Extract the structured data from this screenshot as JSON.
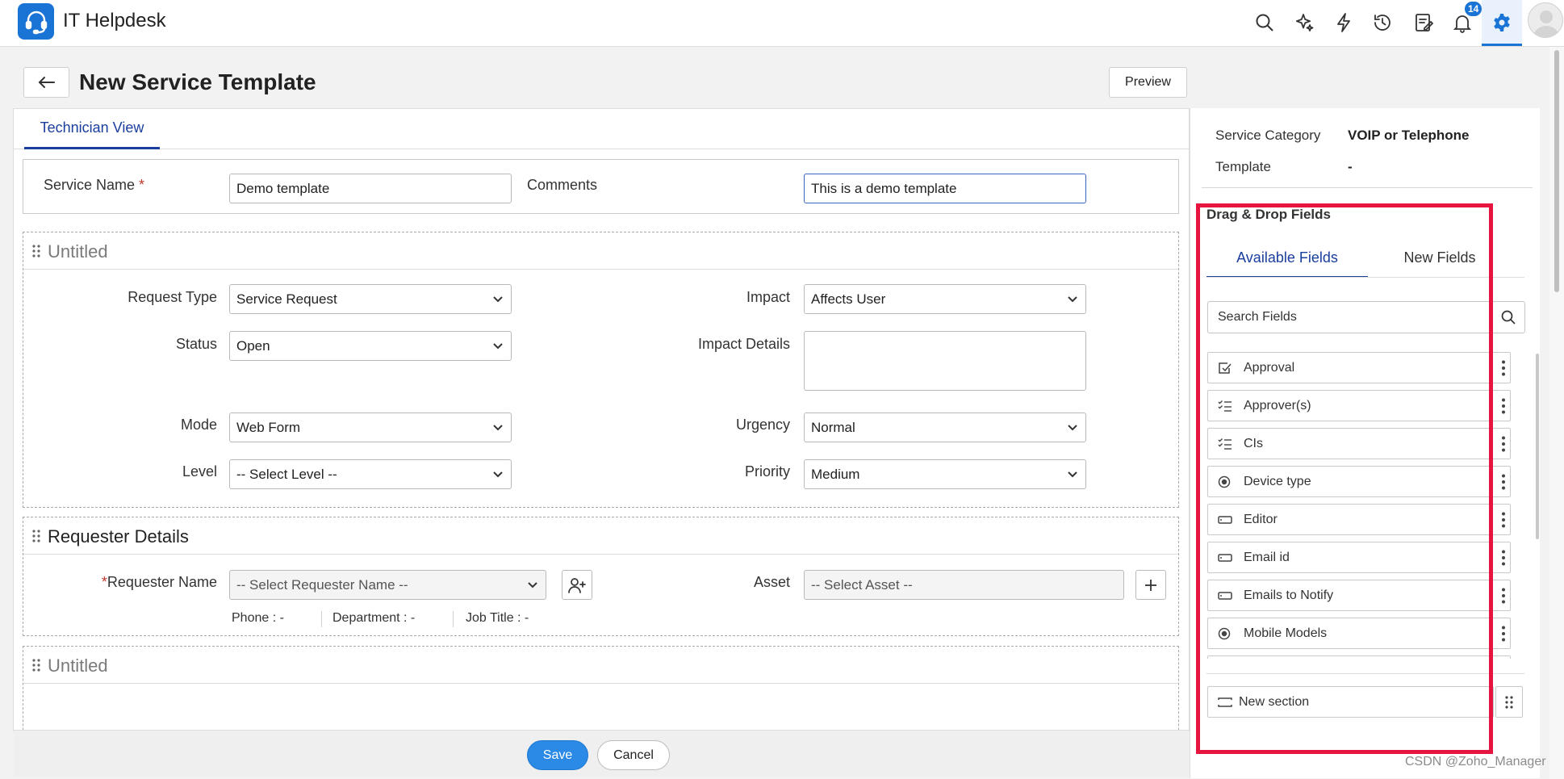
{
  "app": {
    "title": "IT Helpdesk",
    "notification_count": "14"
  },
  "page": {
    "title": "New Service Template",
    "preview_label": "Preview"
  },
  "tabs": [
    {
      "label": "Technician View"
    }
  ],
  "header_section": {
    "service_name_label": "Service Name",
    "service_name_value": "Demo template",
    "comments_label": "Comments",
    "comments_value": "This is a demo template"
  },
  "section1": {
    "title": "Untitled",
    "request_type": {
      "label": "Request Type",
      "value": "Service Request"
    },
    "status": {
      "label": "Status",
      "value": "Open"
    },
    "mode": {
      "label": "Mode",
      "value": "Web Form"
    },
    "level": {
      "label": "Level",
      "value": "-- Select Level --"
    },
    "impact": {
      "label": "Impact",
      "value": "Affects User"
    },
    "impact_details": {
      "label": "Impact Details"
    },
    "urgency": {
      "label": "Urgency",
      "value": "Normal"
    },
    "priority": {
      "label": "Priority",
      "value": "Medium"
    }
  },
  "requester_section": {
    "title": "Requester Details",
    "requester_name": {
      "label": "Requester Name",
      "placeholder": "-- Select Requester Name --"
    },
    "asset": {
      "label": "Asset",
      "placeholder": "-- Select Asset --"
    },
    "phone": "Phone  :  -",
    "department": "Department  :  -",
    "job_title": "Job Title  :  -"
  },
  "section3": {
    "title": "Untitled"
  },
  "footer": {
    "save_label": "Save",
    "cancel_label": "Cancel"
  },
  "right_panel": {
    "service_category_label": "Service Category",
    "service_category_value": "VOIP or Telephone",
    "template_label": "Template",
    "template_value": "-",
    "drag_drop_title": "Drag & Drop Fields",
    "tab_available": "Available Fields",
    "tab_new": "New Fields",
    "search_placeholder": "Search Fields",
    "fields": [
      {
        "label": "Approval",
        "icon": "approval-icon"
      },
      {
        "label": "Approver(s)",
        "icon": "multi-select-icon"
      },
      {
        "label": "CIs",
        "icon": "multi-select-icon"
      },
      {
        "label": "Device type",
        "icon": "radio-icon"
      },
      {
        "label": "Editor",
        "icon": "text-field-icon"
      },
      {
        "label": "Email id",
        "icon": "text-field-icon"
      },
      {
        "label": "Emails to Notify",
        "icon": "text-field-icon"
      },
      {
        "label": "Mobile Models",
        "icon": "radio-icon"
      }
    ],
    "new_section_label": "New section"
  },
  "watermark": "CSDN @Zoho_Manager",
  "colors": {
    "accent": "#1a74d6",
    "highlight": "#e6153f",
    "save": "#2a8ae6"
  }
}
